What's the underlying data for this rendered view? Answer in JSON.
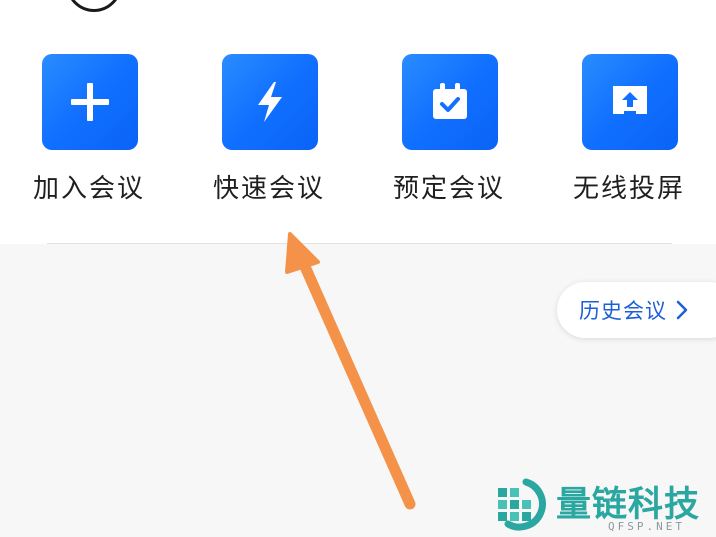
{
  "actions": [
    {
      "label": "加入会议",
      "icon": "plus-icon"
    },
    {
      "label": "快速会议",
      "icon": "lightning-icon"
    },
    {
      "label": "预定会议",
      "icon": "calendar-check-icon"
    },
    {
      "label": "无线投屏",
      "icon": "screen-share-icon"
    }
  ],
  "history": {
    "label": "历史会议",
    "icon": "chevron-right-icon"
  },
  "watermark": {
    "title": "量链科技",
    "subtitle": "QFSP.NET"
  },
  "colors": {
    "tile_blue": "#1170ff",
    "history_text": "#1d5fd6",
    "arrow_orange": "#f5924a",
    "watermark_teal": "#2aa7a0"
  }
}
